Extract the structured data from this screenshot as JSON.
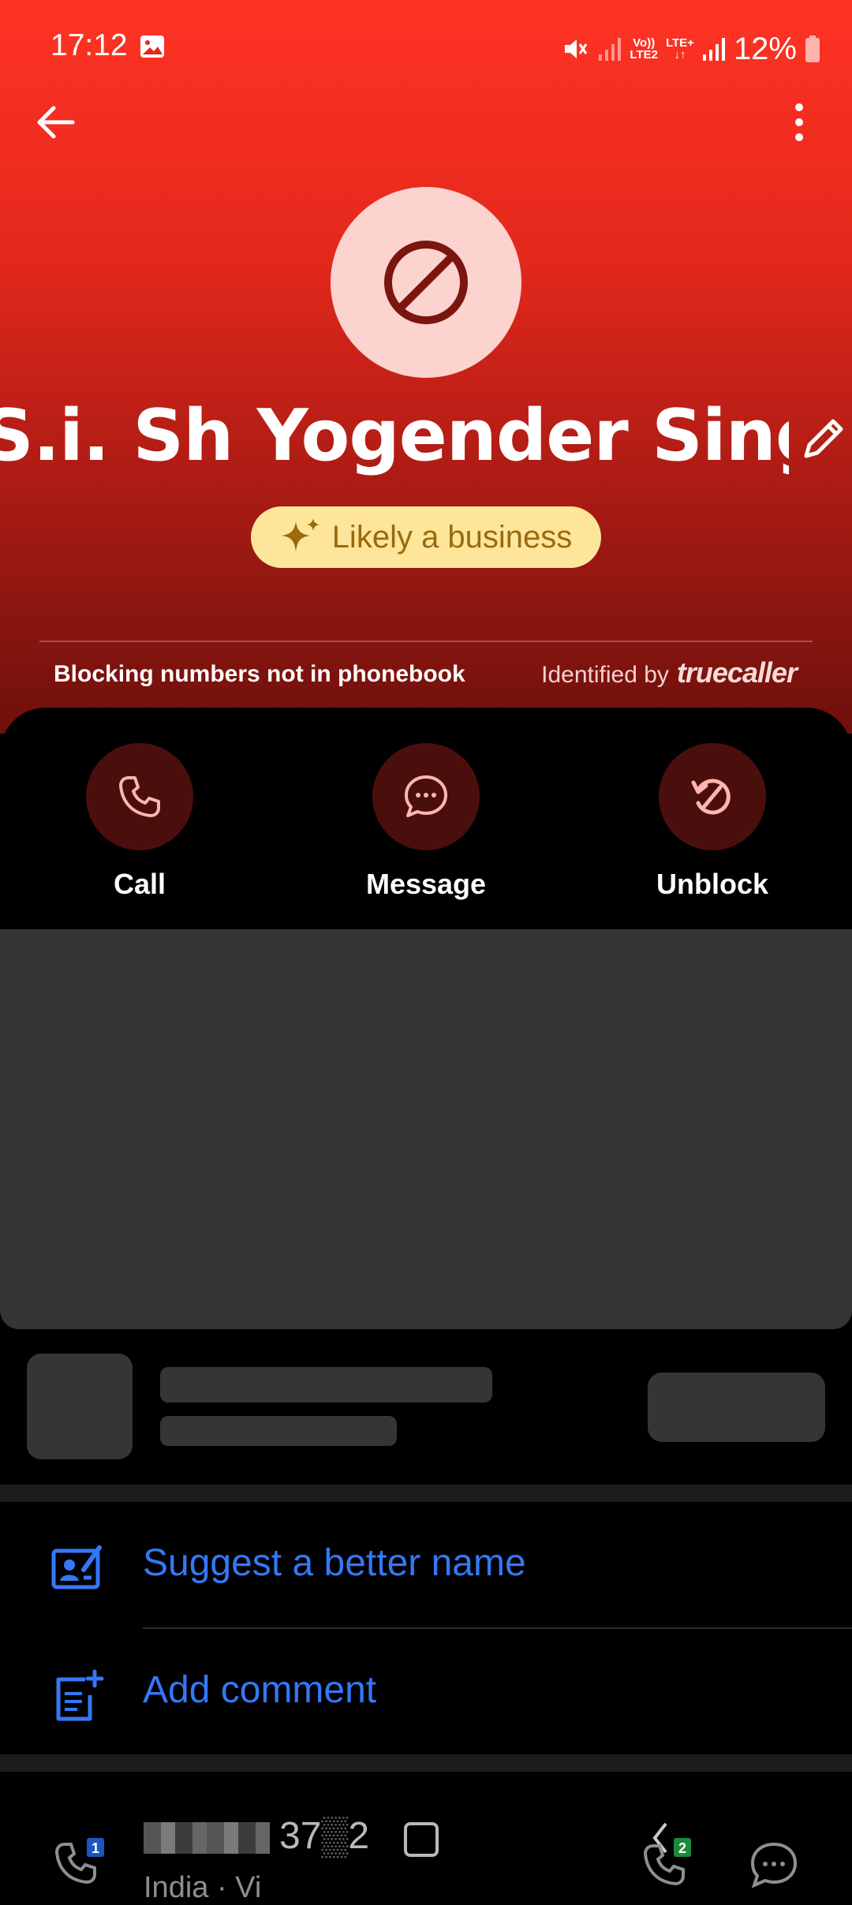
{
  "status_bar": {
    "time": "17:12",
    "battery": "12%",
    "net_top": "Vo))",
    "net_bottom": "LTE2",
    "lte": "LTE+"
  },
  "header": {
    "contact_name": "S.i. Sh Yogender Singh (",
    "badge": "Likely a business",
    "blocking_text": "Blocking numbers not in phonebook",
    "identified_by": "Identified by",
    "brand": "truecaller"
  },
  "actions": [
    {
      "label": "Call",
      "icon": "phone-icon"
    },
    {
      "label": "Message",
      "icon": "chat-bubble-icon"
    },
    {
      "label": "Unblock",
      "icon": "unblock-icon"
    }
  ],
  "menu": {
    "suggest_name": "Suggest a better name",
    "add_comment": "Add comment"
  },
  "call_entry": {
    "number": "37",
    "number_tail": "2",
    "subtext": "India · Vi",
    "sim1": "1",
    "sim2": "2"
  },
  "colors": {
    "header_top": "#ff3324",
    "badge_bg": "#fde69a",
    "link": "#3478f6",
    "action_circle": "#4a0f0c"
  }
}
